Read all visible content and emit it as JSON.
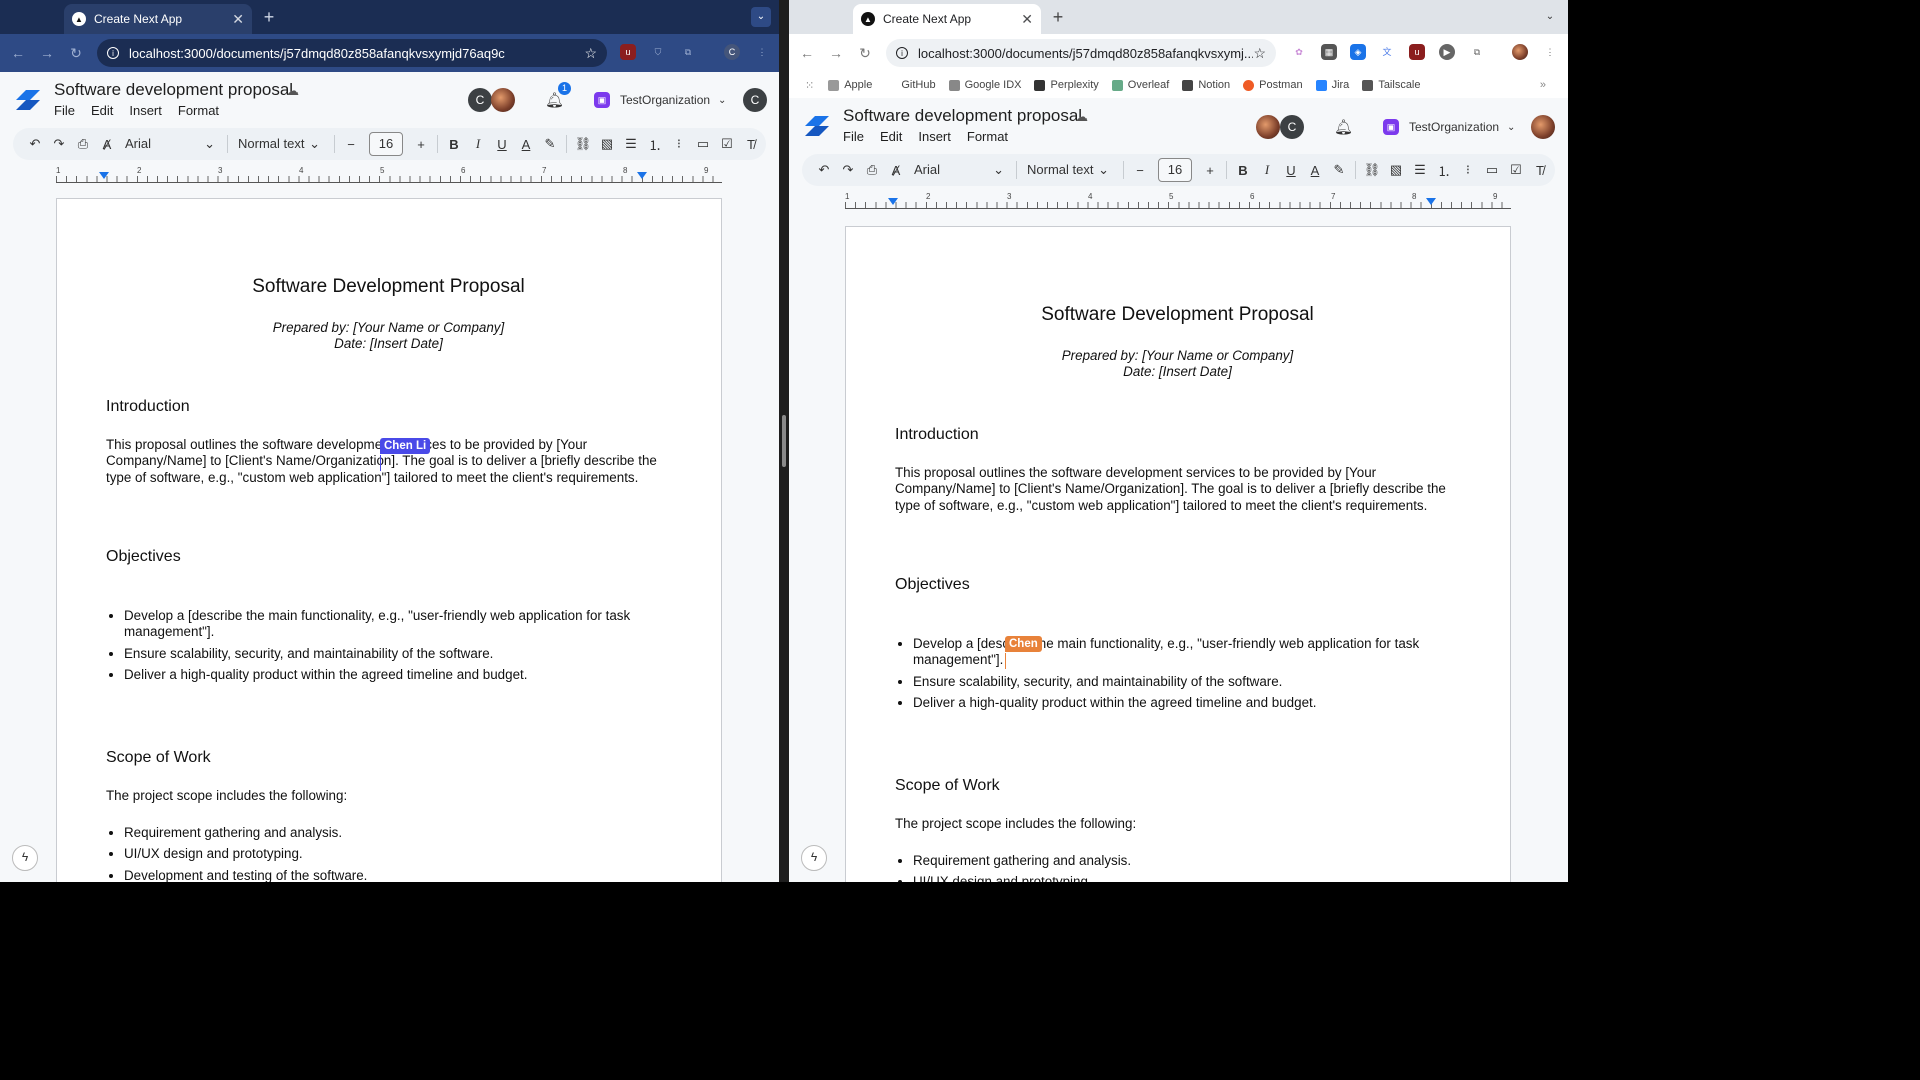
{
  "left": {
    "tab_title": "Create Next App",
    "url": "localhost:3000/documents/j57dmqd80z858afanqkvsxymjd76aq9c",
    "notification_count": "1",
    "cursor_label": "Chen Li",
    "cursor_color": "#4a4ae8"
  },
  "right": {
    "tab_title": "Create Next App",
    "url": "localhost:3000/documents/j57dmqd80z858afanqkvsxymj...",
    "cursor_label": "Chen",
    "cursor_color": "#e8823a",
    "bookmarks": [
      "Apple",
      "GitHub",
      "Google IDX",
      "Perplexity",
      "Overleaf",
      "Notion",
      "Postman",
      "Jira",
      "Tailscale"
    ]
  },
  "app": {
    "doc_title": "Software development proposal",
    "menu": [
      "File",
      "Edit",
      "Insert",
      "Format"
    ],
    "org_name": "TestOrganization",
    "avatar_letter": "C",
    "font": "Arial",
    "text_style": "Normal text",
    "font_size": "16",
    "ruler_numbers": [
      "1",
      "2",
      "3",
      "4",
      "5",
      "6",
      "7",
      "8",
      "9"
    ]
  },
  "doc": {
    "title": "Software Development Proposal",
    "prepared_by": "Prepared by: [Your Name or Company]",
    "date": "Date: [Insert Date]",
    "intro_heading": "Introduction",
    "intro_text": "This proposal outlines the software development services to be provided by [Your Company/Name] to [Client's Name/Organization]. The goal is to deliver a [briefly describe the type of software, e.g., \"custom web application\"] tailored to meet the client's requirements.",
    "objectives_heading": "Objectives",
    "objectives": [
      "Develop a [describe the main functionality, e.g., \"user-friendly web application for task management\"].",
      "Ensure scalability, security, and maintainability of the software.",
      "Deliver a high-quality product within the agreed timeline and budget."
    ],
    "scope_heading": "Scope of Work",
    "scope_intro": "The project scope includes the following:",
    "scope_items": [
      "Requirement gathering and analysis.",
      "UI/UX design and prototyping.",
      "Development and testing of the software."
    ]
  }
}
